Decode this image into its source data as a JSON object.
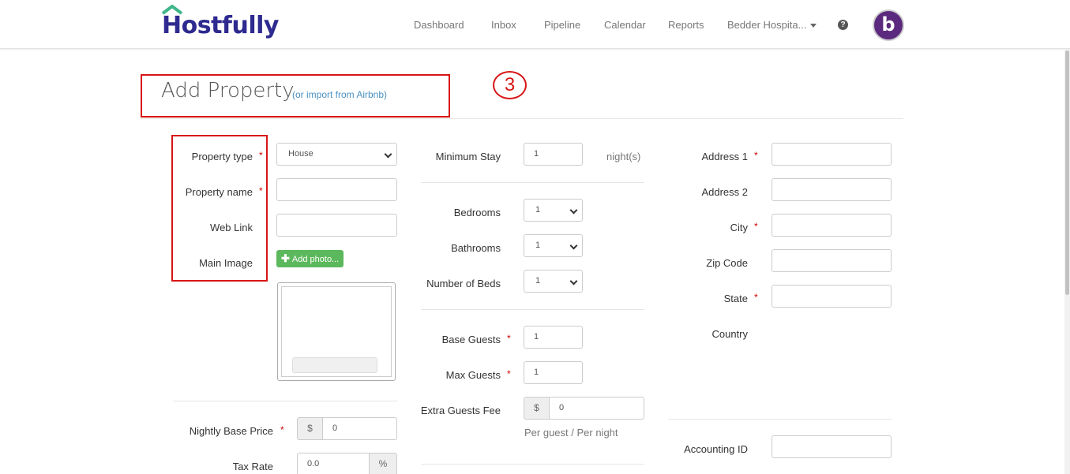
{
  "app": {
    "logo_text": "Hostfully",
    "brand_color": "#2e2a8f",
    "accent_color": "#3fb58a"
  },
  "nav": {
    "items": [
      "Dashboard",
      "Inbox",
      "Pipeline",
      "Calendar",
      "Reports"
    ],
    "account_label": "Bedder Hospita...",
    "help_icon": "question-circle-icon",
    "avatar_letter": "b"
  },
  "page": {
    "title": "Add Property",
    "import_link": "(or import from Airbnb)",
    "step_annotation": "3"
  },
  "left": {
    "property_type_label": "Property type",
    "property_type_value": "House",
    "property_name_label": "Property name",
    "web_link_label": "Web Link",
    "main_image_label": "Main Image",
    "add_photo_label": "Add photo...",
    "nightly_price_label": "Nightly Base Price",
    "nightly_price_currency": "$",
    "nightly_price_value": "0",
    "tax_rate_label": "Tax Rate",
    "tax_rate_value": "0.0",
    "tax_rate_unit": "%"
  },
  "middle": {
    "min_stay_label": "Minimum Stay",
    "min_stay_value": "1",
    "min_stay_unit": "night(s)",
    "bedrooms_label": "Bedrooms",
    "bedrooms_value": "1",
    "bathrooms_label": "Bathrooms",
    "bathrooms_value": "1",
    "beds_label": "Number of Beds",
    "beds_value": "1",
    "base_guests_label": "Base Guests",
    "base_guests_value": "1",
    "max_guests_label": "Max Guests",
    "max_guests_value": "1",
    "extra_fee_label": "Extra Guests Fee",
    "extra_fee_currency": "$",
    "extra_fee_value": "0",
    "extra_fee_hint": "Per guest / Per night"
  },
  "right": {
    "address1_label": "Address 1",
    "address2_label": "Address 2",
    "city_label": "City",
    "zip_label": "Zip Code",
    "state_label": "State",
    "country_label": "Country",
    "accounting_label": "Accounting ID"
  },
  "required_marker": "*"
}
